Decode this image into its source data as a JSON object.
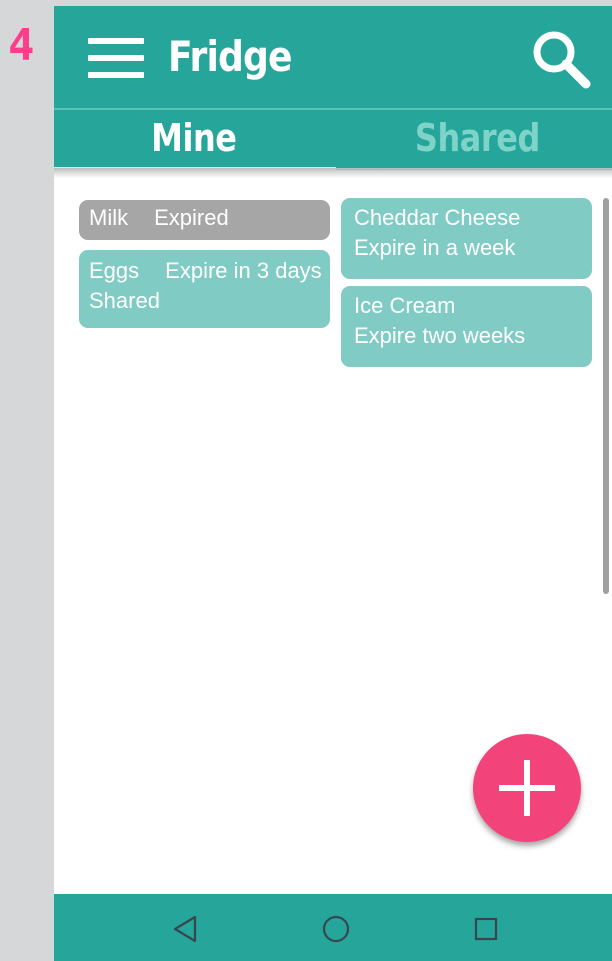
{
  "step_number": "4",
  "app_bar": {
    "title": "Fridge",
    "menu_icon": "hamburger-menu-icon",
    "search_icon": "search-icon"
  },
  "tabs": [
    {
      "label": "Mine",
      "selected": true
    },
    {
      "label": "Shared",
      "selected": false
    }
  ],
  "items_left": [
    {
      "name": "Milk",
      "status": "Expired",
      "extra": "",
      "color": "#a6a6a6"
    },
    {
      "name": "Eggs",
      "status": "Expire in 3 days",
      "extra": "Shared",
      "color": "#80cbc4"
    }
  ],
  "items_right": [
    {
      "name": "Cheddar Cheese",
      "status": "Expire in a week",
      "color": "#80cbc4"
    },
    {
      "name": "Ice Cream",
      "status": "Expire two weeks",
      "color": "#80cbc4"
    }
  ],
  "fab": {
    "icon": "plus-icon",
    "color": "#f2437a"
  },
  "nav": {
    "icons": [
      "back-triangle-icon",
      "home-circle-icon",
      "recents-square-icon"
    ]
  },
  "colors": {
    "primary": "#26a69a",
    "card": "#80cbc4",
    "expired_card": "#a6a6a6",
    "accent": "#ff3d8a"
  }
}
